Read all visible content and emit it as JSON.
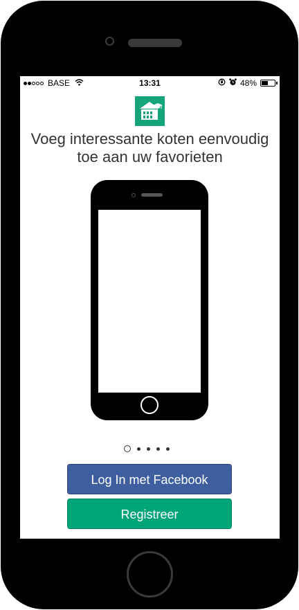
{
  "status_bar": {
    "carrier": "BASE",
    "time": "13:31",
    "battery_percent": "48%",
    "battery_level": 0.48,
    "signal_strength": 2,
    "icons": [
      "wifi-icon",
      "rotation-lock-icon",
      "alarm-icon",
      "battery-icon"
    ]
  },
  "onboarding": {
    "logo_icon": "building-graduation-cap-icon",
    "headline_line1": "Voeg interessante koten eenvoudig",
    "headline_line2": "toe aan uw favorieten",
    "page_count": 5,
    "active_page": 1
  },
  "buttons": {
    "facebook_label": "Log In met Facebook",
    "register_label": "Registreer"
  },
  "colors": {
    "brand_green": "#16a57b",
    "facebook_blue": "#3f5ea0",
    "register_green": "#00a479"
  }
}
